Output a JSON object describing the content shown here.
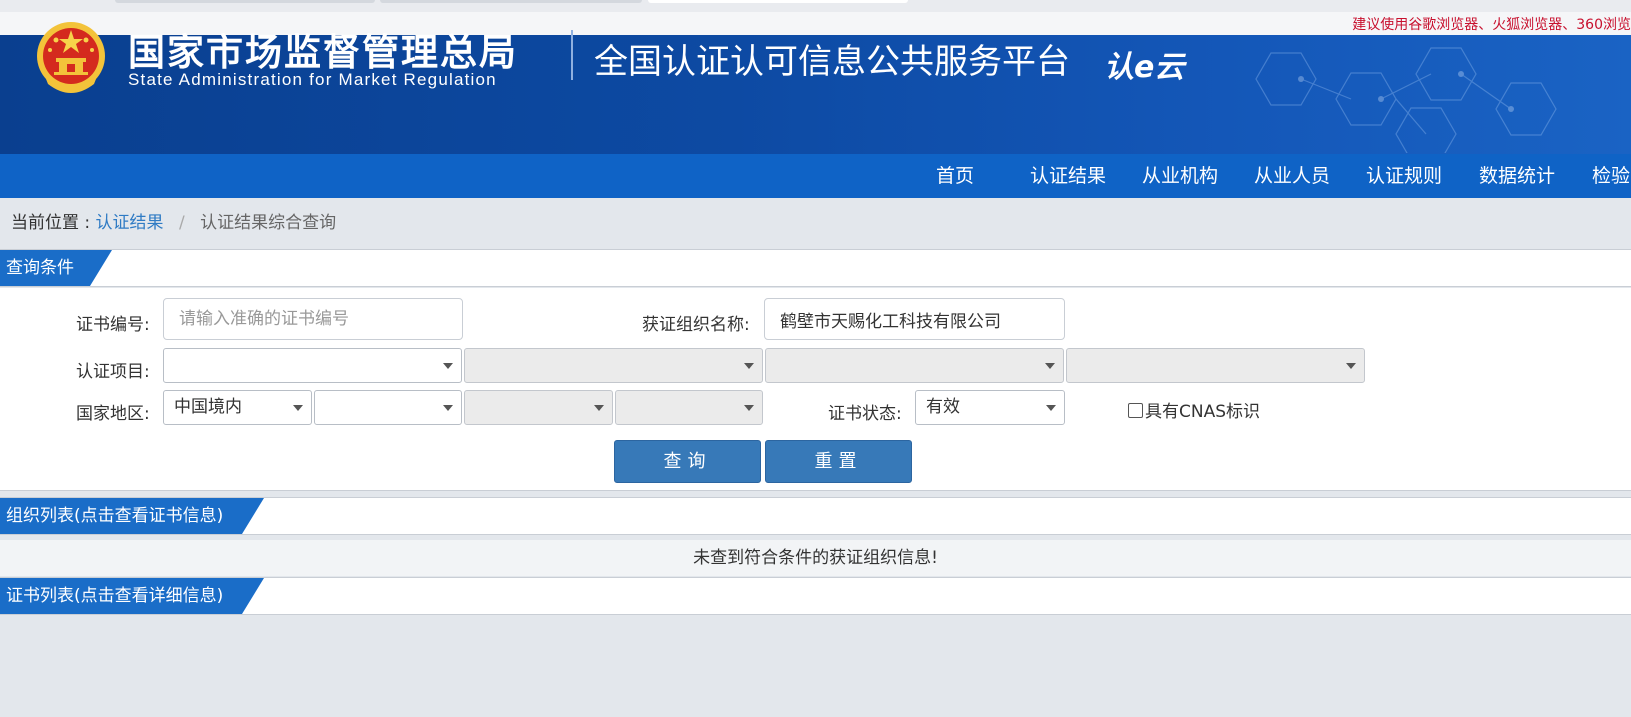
{
  "notice": "建议使用谷歌浏览器、火狐浏览器、360浏览",
  "header": {
    "org_cn": "国家市场监督管理总局",
    "org_en": "State Administration  for  Market Regulation",
    "platform": "全国认证认可信息公共服务平台",
    "brand": "认e云"
  },
  "nav": [
    "首页",
    "认证结果",
    "从业机构",
    "从业人员",
    "认证规则",
    "数据统计",
    "检验"
  ],
  "breadcrumb": {
    "label": "当前位置 :",
    "link": "认证结果",
    "separator": "/",
    "current": "认证结果综合查询"
  },
  "sections": {
    "query": "查询条件",
    "org_list": "组织列表(点击查看证书信息)",
    "cert_list": "证书列表(点击查看详细信息)"
  },
  "form": {
    "cert_no_label": "证书编号:",
    "cert_no_placeholder": "请输入准确的证书编号",
    "cert_no_value": "",
    "org_name_label": "获证组织名称:",
    "org_name_value": "鹤壁市天赐化工科技有限公司",
    "project_label": "认证项目:",
    "region_label": "国家地区:",
    "region_value": "中国境内",
    "status_label": "证书状态:",
    "status_value": "有效",
    "cnas_label": "具有CNAS标识",
    "cnas_checked": false,
    "query_button": "查询",
    "reset_button": "重置"
  },
  "org_list_empty": "未查到符合条件的获证组织信息!",
  "colors": {
    "nav": "#0f63c6",
    "header": "#0d4aa3",
    "notice": "#c8102e",
    "button": "#3779b8",
    "link": "#2f7bc4"
  }
}
